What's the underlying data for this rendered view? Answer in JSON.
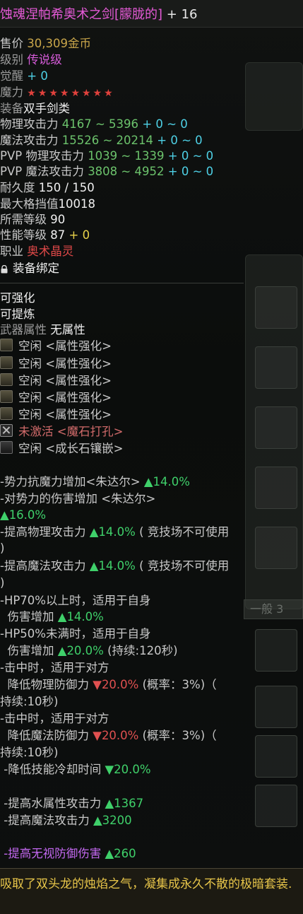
{
  "title": {
    "name": "蚀魂涅帕希奥术之剑[朦胧的]",
    "enhance": "+ 16"
  },
  "stats": {
    "price_label": "售价",
    "price_value": "30,309金币",
    "grade_label": "级别",
    "grade_value": "传说级",
    "awaken_label": "觉醒",
    "awaken_value": "+ 0",
    "magic_label": "魔力",
    "magic_stars": "★★★★★★★★",
    "equip_label": "装备",
    "equip_value": "双手剑类",
    "phys_atk_label": "物理攻击力",
    "phys_atk_value": "4167 ~ 5396",
    "phys_atk_bonus": "+ 0 ~ 0",
    "mag_atk_label": "魔法攻击力",
    "mag_atk_value": "15526 ~ 20214",
    "mag_atk_bonus": "+ 0 ~ 0",
    "pvp_phys_label": "PVP 物理攻击力",
    "pvp_phys_value": "1039 ~ 1339",
    "pvp_phys_bonus": "+ 0 ~ 0",
    "pvp_mag_label": "PVP 魔法攻击力",
    "pvp_mag_value": "3808 ~ 4952",
    "pvp_mag_bonus": "+ 0 ~ 0",
    "durability_label": "耐久度",
    "durability_value": "150 / 150",
    "block_label": "最大格挡值",
    "block_value": "10018",
    "level_label": "所需等级",
    "level_value": "90",
    "perf_label": "性能等级",
    "perf_value": "87",
    "perf_bonus": "+ 0",
    "job_label": "职业",
    "job_value": "奥术晶灵",
    "bound_label": "装备绑定"
  },
  "enhance": {
    "enhanceable": "可强化",
    "refinable": "可提炼",
    "attr_label": "武器属性",
    "attr_value": "无属性",
    "slots": [
      {
        "text": "空闲 <属性强化>"
      },
      {
        "text": "空闲 <属性强化>"
      },
      {
        "text": "空闲 <属性强化>"
      },
      {
        "text": "空闲 <属性强化>"
      },
      {
        "text": "空闲 <属性强化>"
      }
    ],
    "inactive_label": "未激活",
    "inactive_value": "<魔石打孔>",
    "growth_slot": "空闲 <成长石镶嵌>"
  },
  "effects": {
    "e1_text": "-势力抗魔力增加<朱达尔>",
    "e1_val": "▲14.0%",
    "e2_text": "-对势力的伤害增加 <朱达尔>",
    "e2_val": "▲16.0%",
    "e3_text": "-提高物理攻击力",
    "e3_val": "▲14.0%",
    "e3_note": "( 竞技场不可使用",
    "e3_close": ")",
    "e4_text": "-提高魔法攻击力",
    "e4_val": "▲14.0%",
    "e4_note": "( 竞技场不可使用",
    "e4_close": ")",
    "e5_text": "-HP70%以上时，适用于自身",
    "e5_sub": "伤害增加",
    "e5_val": "▲14.0%",
    "e6_text": "-HP50%未满时，适用于自身",
    "e6_sub": "伤害增加",
    "e6_val": "▲20.0%",
    "e6_note": "(持续:120秒)",
    "e7_text": "-击中时，适用于对方",
    "e7_sub": "降低物理防御力",
    "e7_val": "▼20.0%",
    "e7_note": "(概率：3%)（",
    "e7_dur": "持续:10秒)",
    "e8_text": "-击中时，适用于对方",
    "e8_sub": "降低魔法防御力",
    "e8_val": "▼20.0%",
    "e8_note": "(概率：3%)（",
    "e8_dur": "持续:10秒)",
    "e9_text": "-降低技能冷却时间",
    "e9_val": "▼20.0%",
    "e10_text": "-提高水属性攻击力",
    "e10_val": "▲1367",
    "e11_text": "-提高魔法攻击力",
    "e11_val": "▲3200",
    "e12_text": "-提高无视防御伤害",
    "e12_val": "▲260"
  },
  "description": "吸取了双头龙的烛焰之气，凝集成永久不散的极暗套装.",
  "background": {
    "tab_label": "一般 3"
  }
}
